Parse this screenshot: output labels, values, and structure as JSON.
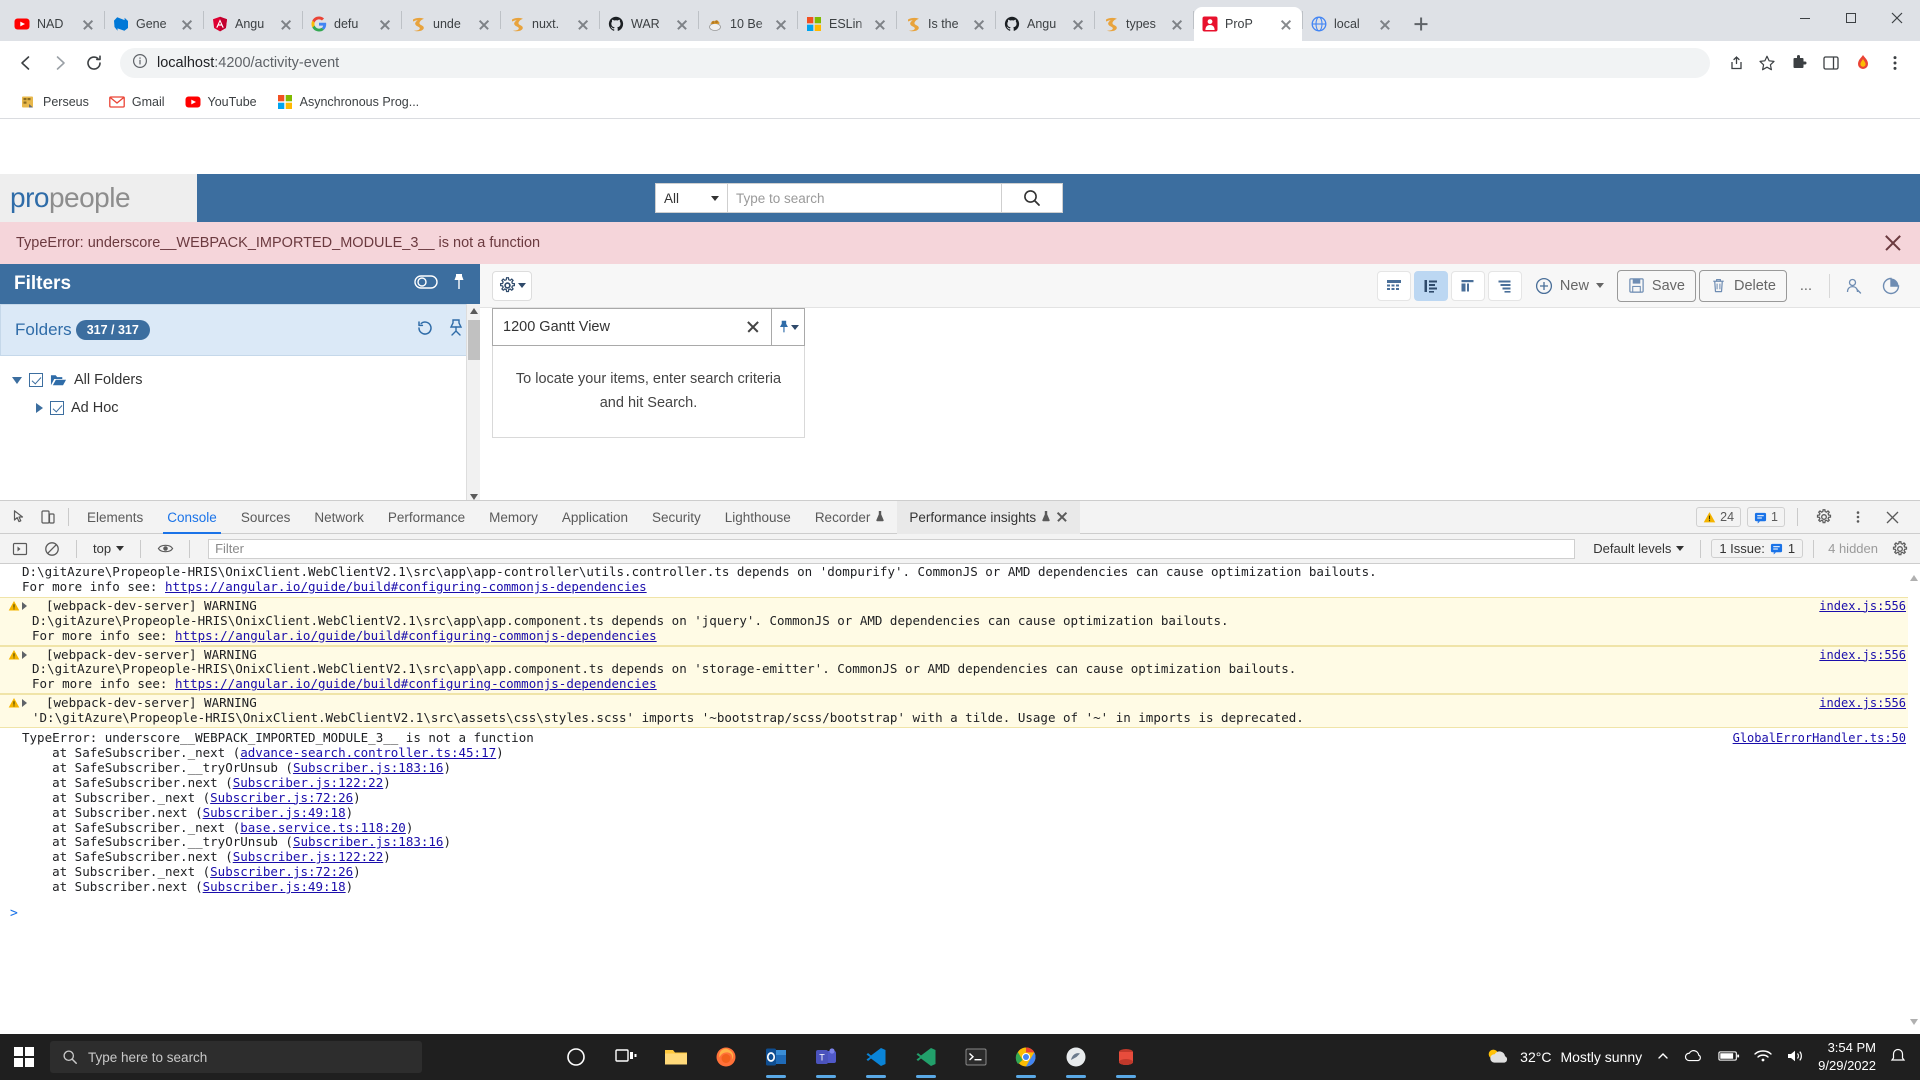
{
  "browser": {
    "tabs": [
      {
        "title": "NAD",
        "icon": "youtube-icon",
        "active": false
      },
      {
        "title": "Gene",
        "icon": "azure-devops-icon",
        "active": false
      },
      {
        "title": "Angu",
        "icon": "angular-icon",
        "active": false
      },
      {
        "title": "defu",
        "icon": "google-icon",
        "active": false
      },
      {
        "title": "unde",
        "icon": "javascript-icon",
        "active": false
      },
      {
        "title": "nuxt.",
        "icon": "javascript-icon",
        "active": false
      },
      {
        "title": "WAR",
        "icon": "github-icon",
        "active": false
      },
      {
        "title": "10 Be",
        "icon": "honeypot-icon",
        "active": false
      },
      {
        "title": "ESLin",
        "icon": "microsoft-icon",
        "active": false
      },
      {
        "title": "Is the",
        "icon": "javascript-icon",
        "active": false
      },
      {
        "title": "Angu",
        "icon": "github-icon",
        "active": false
      },
      {
        "title": "types",
        "icon": "javascript-icon",
        "active": false
      },
      {
        "title": "ProP",
        "icon": "propeople-icon",
        "active": true
      },
      {
        "title": "local",
        "icon": "globe-icon",
        "active": false
      }
    ],
    "new_tab_label": "+",
    "url_scheme": "localhost",
    "url_path": ":4200/activity-event",
    "bookmarks": [
      {
        "label": "Perseus",
        "icon": "perseus-icon"
      },
      {
        "label": "Gmail",
        "icon": "gmail-icon"
      },
      {
        "label": "YouTube",
        "icon": "youtube-icon"
      },
      {
        "label": "Asynchronous Prog...",
        "icon": "microsoft-icon"
      }
    ]
  },
  "app": {
    "logo_pro": "pro",
    "logo_people": "people",
    "search_scope": "All",
    "search_placeholder": "Type to search",
    "error_banner": "TypeError: underscore__WEBPACK_IMPORTED_MODULE_3__ is not a function",
    "filters": {
      "title": "Filters",
      "folders_label": "Folders",
      "folders_count": "317 / 317",
      "tree": [
        {
          "label": "All Folders",
          "level": 1,
          "checked": true,
          "expanded": true
        },
        {
          "label": "Ad Hoc",
          "level": 2,
          "checked": true,
          "expanded": false
        }
      ]
    },
    "toolbar": {
      "view_grid": "grid-view",
      "view_list": "list-view",
      "view_columns": "column-view",
      "view_compact": "compact-view",
      "new_label": "New",
      "save_label": "Save",
      "delete_label": "Delete",
      "more_label": "...",
      "find_icon": "find-person-icon",
      "chart_icon": "pie-chart-icon"
    },
    "gantt_search": {
      "value": "1200 Gantt View",
      "empty_message_line1": "To locate your items, enter search criteria",
      "empty_message_line2": "and hit Search."
    }
  },
  "devtools": {
    "tabs": [
      {
        "label": "Elements",
        "active": false
      },
      {
        "label": "Console",
        "active": true
      },
      {
        "label": "Sources",
        "active": false
      },
      {
        "label": "Network",
        "active": false
      },
      {
        "label": "Performance",
        "active": false
      },
      {
        "label": "Memory",
        "active": false
      },
      {
        "label": "Application",
        "active": false
      },
      {
        "label": "Security",
        "active": false
      },
      {
        "label": "Lighthouse",
        "active": false
      },
      {
        "label": "Recorder",
        "active": false,
        "beta": true
      },
      {
        "label": "Performance insights",
        "active": false,
        "beta": true,
        "closable": true
      }
    ],
    "warning_count": "24",
    "issue_count": "1",
    "console": {
      "context": "top",
      "filter_placeholder": "Filter",
      "levels": "Default levels",
      "issues_label": "1 Issue:",
      "issues_value": "1",
      "hidden_label": "4 hidden"
    },
    "messages": [
      {
        "type": "plain",
        "lines": [
          "D:\\gitAzure\\Propeople-HRIS\\OnixClient.WebClientV2.1\\src\\app\\app-controller\\utils.controller.ts depends on 'dompurify'. CommonJS or AMD dependencies can cause optimization bailouts.",
          "For more info see: https://angular.io/guide/build#configuring-commonjs-dependencies"
        ],
        "link": "https://angular.io/guide/build#configuring-commonjs-dependencies",
        "source": ""
      },
      {
        "type": "warning",
        "header": "[webpack-dev-server] WARNING",
        "lines": [
          "D:\\gitAzure\\Propeople-HRIS\\OnixClient.WebClientV2.1\\src\\app\\app.component.ts depends on 'jquery'. CommonJS or AMD dependencies can cause optimization bailouts.",
          "For more info see: https://angular.io/guide/build#configuring-commonjs-dependencies"
        ],
        "link": "https://angular.io/guide/build#configuring-commonjs-dependencies",
        "source": "index.js:556"
      },
      {
        "type": "warning",
        "header": "[webpack-dev-server] WARNING",
        "lines": [
          "D:\\gitAzure\\Propeople-HRIS\\OnixClient.WebClientV2.1\\src\\app\\app.component.ts depends on 'storage-emitter'. CommonJS or AMD dependencies can cause optimization bailouts.",
          "For more info see: https://angular.io/guide/build#configuring-commonjs-dependencies"
        ],
        "link": "https://angular.io/guide/build#configuring-commonjs-dependencies",
        "source": "index.js:556"
      },
      {
        "type": "warning",
        "header": "[webpack-dev-server] WARNING",
        "lines": [
          "'D:\\gitAzure\\Propeople-HRIS\\OnixClient.WebClientV2.1\\src\\assets\\css\\styles.scss' imports '~bootstrap/scss/bootstrap' with a tilde. Usage of '~' in imports is deprecated."
        ],
        "link": "",
        "source": "index.js:556"
      }
    ],
    "error": {
      "title": "TypeError: underscore__WEBPACK_IMPORTED_MODULE_3__ is not a function",
      "source": "GlobalErrorHandler.ts:50",
      "stack": [
        {
          "text": "    at SafeSubscriber._next (",
          "link": "advance-search.controller.ts:45:17",
          "tail": ")"
        },
        {
          "text": "    at SafeSubscriber.__tryOrUnsub (",
          "link": "Subscriber.js:183:16",
          "tail": ")"
        },
        {
          "text": "    at SafeSubscriber.next (",
          "link": "Subscriber.js:122:22",
          "tail": ")"
        },
        {
          "text": "    at Subscriber._next (",
          "link": "Subscriber.js:72:26",
          "tail": ")"
        },
        {
          "text": "    at Subscriber.next (",
          "link": "Subscriber.js:49:18",
          "tail": ")"
        },
        {
          "text": "    at SafeSubscriber._next (",
          "link": "base.service.ts:118:20",
          "tail": ")"
        },
        {
          "text": "    at SafeSubscriber.__tryOrUnsub (",
          "link": "Subscriber.js:183:16",
          "tail": ")"
        },
        {
          "text": "    at SafeSubscriber.next (",
          "link": "Subscriber.js:122:22",
          "tail": ")"
        },
        {
          "text": "    at Subscriber._next (",
          "link": "Subscriber.js:72:26",
          "tail": ")"
        },
        {
          "text": "    at Subscriber.next (",
          "link": "Subscriber.js:49:18",
          "tail": ")"
        }
      ]
    }
  },
  "taskbar": {
    "search_placeholder": "Type here to search",
    "apps": [
      {
        "name": "cortana-icon"
      },
      {
        "name": "task-view-icon"
      },
      {
        "name": "file-explorer-icon"
      },
      {
        "name": "firefox-icon"
      },
      {
        "name": "outlook-icon"
      },
      {
        "name": "teams-icon"
      },
      {
        "name": "vscode-icon"
      },
      {
        "name": "vscode-insiders-icon"
      },
      {
        "name": "terminal-icon"
      },
      {
        "name": "chrome-icon"
      },
      {
        "name": "postman-icon"
      },
      {
        "name": "sql-server-icon"
      }
    ],
    "weather_temp": "32°C",
    "weather_desc": "Mostly sunny",
    "time": "3:54 PM",
    "date": "9/29/2022"
  },
  "colors": {
    "app_blue": "#3c6e9f",
    "error_bg": "#f5d5da",
    "accent": "#1a73e8"
  }
}
